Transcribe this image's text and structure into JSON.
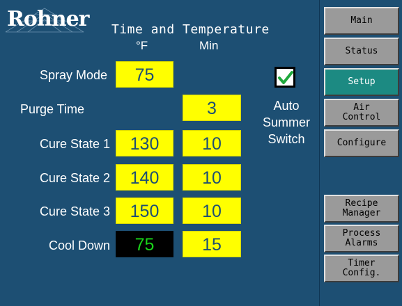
{
  "header": {
    "logo_text": "Rohner",
    "title": "Time and Temperature",
    "col_temp": "°F",
    "col_min": "Min"
  },
  "rows": [
    {
      "label": "Spray Mode",
      "temp": "75",
      "min": ""
    },
    {
      "label": "Purge Time",
      "temp": "",
      "min": "3"
    },
    {
      "label": "Cure State 1",
      "temp": "130",
      "min": "10"
    },
    {
      "label": "Cure State 2",
      "temp": "140",
      "min": "10"
    },
    {
      "label": "Cure State 3",
      "temp": "150",
      "min": "10"
    },
    {
      "label": "Cool Down",
      "temp": "75",
      "min": "15"
    }
  ],
  "auto_summer": {
    "checked": true,
    "label_line1": "Auto",
    "label_line2": "Summer",
    "label_line3": "Switch"
  },
  "nav": {
    "main": "Main",
    "status": "Status",
    "setup": "Setup",
    "air_control": "Air\nControl",
    "configure": "Configure",
    "recipe_manager": "Recipe\nManager",
    "process_alarms": "Process\nAlarms",
    "timer_config": "Timer\nConfig."
  },
  "colors": {
    "background": "#1d4f73",
    "field": "#ffff00",
    "field_readonly": "#000000",
    "readonly_text": "#19d419",
    "active_button": "#1c8a82",
    "button": "#9a9a9a"
  },
  "icons": {
    "checkbox": "checkmark-icon"
  }
}
